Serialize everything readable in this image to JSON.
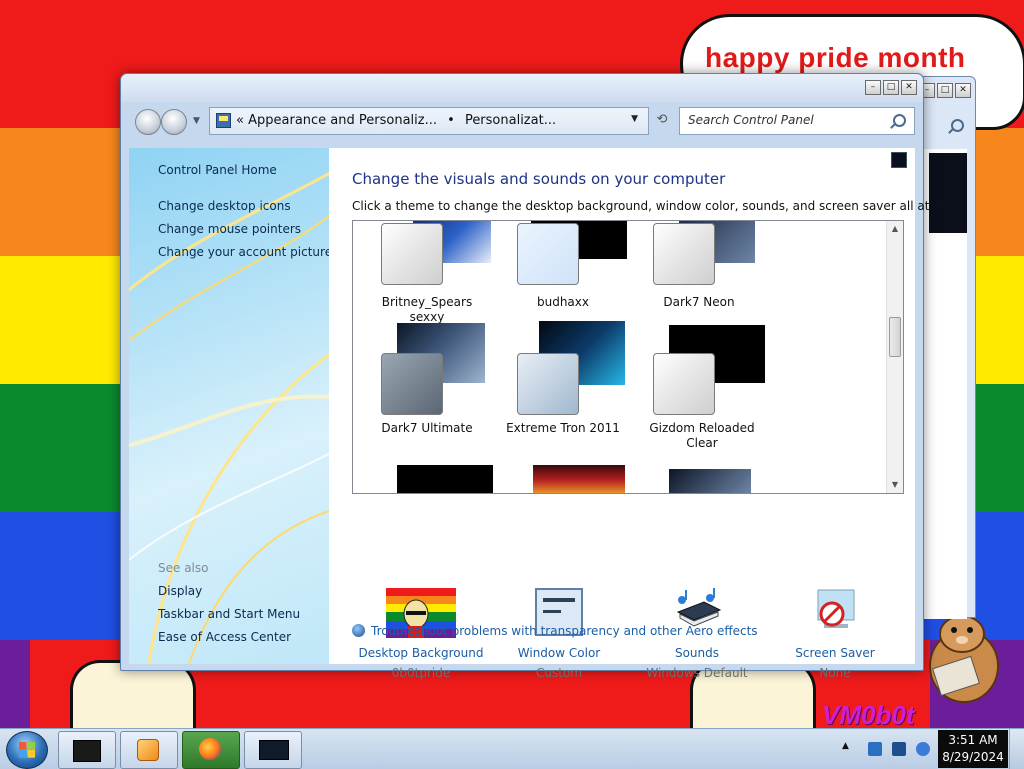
{
  "desktop": {
    "speech_text": "happy pride month",
    "watermark": "VM0b0t",
    "colors": [
      "#ef1a1a",
      "#f7871c",
      "#ffea00",
      "#0a8a2c",
      "#1f4fe3",
      "#6c1e9a"
    ]
  },
  "window": {
    "caption_buttons": [
      "minimize-icon",
      "maximize-icon",
      "close-icon"
    ],
    "address": {
      "prefix": "«",
      "crumb1": "Appearance and Personaliz...",
      "separator": "•",
      "crumb2": "Personalizat..."
    },
    "search": {
      "placeholder": "Search Control Panel"
    }
  },
  "left_nav": {
    "home": "Control Panel Home",
    "links": [
      "Change desktop icons",
      "Change mouse pointers",
      "Change your account picture"
    ],
    "see_also_heading": "See also",
    "see_also": [
      "Display",
      "Taskbar and Start Menu",
      "Ease of Access Center"
    ]
  },
  "content": {
    "title": "Change the visuals and sounds on your computer",
    "subtitle": "Click a theme to change the desktop background, window color, sounds, and screen saver all at once.",
    "themes": [
      {
        "label": "Britney_Spears sexxy"
      },
      {
        "label": "budhaxx"
      },
      {
        "label": "Dark7 Neon"
      },
      {
        "label": "Dark7 Ultimate"
      },
      {
        "label": "Extreme Tron 2011"
      },
      {
        "label": "Gizdom Reloaded Clear"
      }
    ],
    "settings": [
      {
        "name": "Desktop Background",
        "value": "0b0tpride",
        "icon": "desktop-background-icon"
      },
      {
        "name": "Window Color",
        "value": "Custom",
        "icon": "window-color-icon"
      },
      {
        "name": "Sounds",
        "value": "Windows Default",
        "icon": "sounds-icon"
      },
      {
        "name": "Screen Saver",
        "value": "None",
        "icon": "screen-saver-icon"
      }
    ],
    "troubleshoot": "Troubleshoot problems with transparency and other Aero effects"
  },
  "taskbar": {
    "items": [
      "explorer-icon",
      "media-player-icon",
      "firefox-icon",
      "control-panel-icon"
    ],
    "time": "3:51 AM",
    "date": "8/29/2024"
  }
}
